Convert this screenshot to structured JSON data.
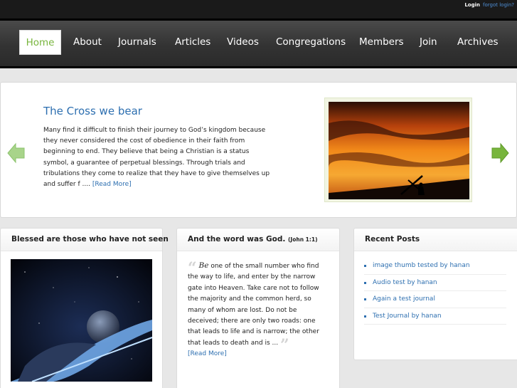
{
  "topbar": {
    "login": "Login",
    "forgot": "forgot login?"
  },
  "nav": {
    "items": [
      "Home",
      "About",
      "Journals",
      "Articles",
      "Videos",
      "Congregations",
      "Members",
      "Join",
      "Archives"
    ],
    "active": "Home"
  },
  "hero": {
    "title": "The Cross we bear",
    "text": "Many find it difficult to finish their journey to God’s kingdom because they never considered the cost of obedience in their faith from beginning to end. They believe that being a Christian is a status symbol, a guarantee of perpetual blessings. Through trials and tribulations they come to realize that they have to give themselves up and suffer f ....",
    "read_more": "[Read More]",
    "prev_icon": "arrow-left-icon",
    "next_icon": "arrow-right-icon"
  },
  "panel1": {
    "title": "Blessed are those who have not seen"
  },
  "panel2": {
    "title": "And the word was God.",
    "title_ref": "(John 1:1)",
    "quote_first": "Be",
    "quote_rest": " one of the small number who find the way to life, and enter by the narrow gate into Heaven. Take care not to follow the majority and the common herd, so many of whom are lost. Do not be deceived; there are only two roads: one that leads to life and is narrow; the other that leads to death and is ...",
    "read_more": "[Read More]"
  },
  "panel3": {
    "title": "Recent Posts",
    "posts": [
      "image thumb tested by hanan",
      "Audio test by hanan",
      "Again a test journal",
      "Test Journal by hanan"
    ]
  },
  "colors": {
    "link": "#2d6fb0",
    "active_nav": "#78b53d",
    "arrow_green": "#78b53d"
  }
}
